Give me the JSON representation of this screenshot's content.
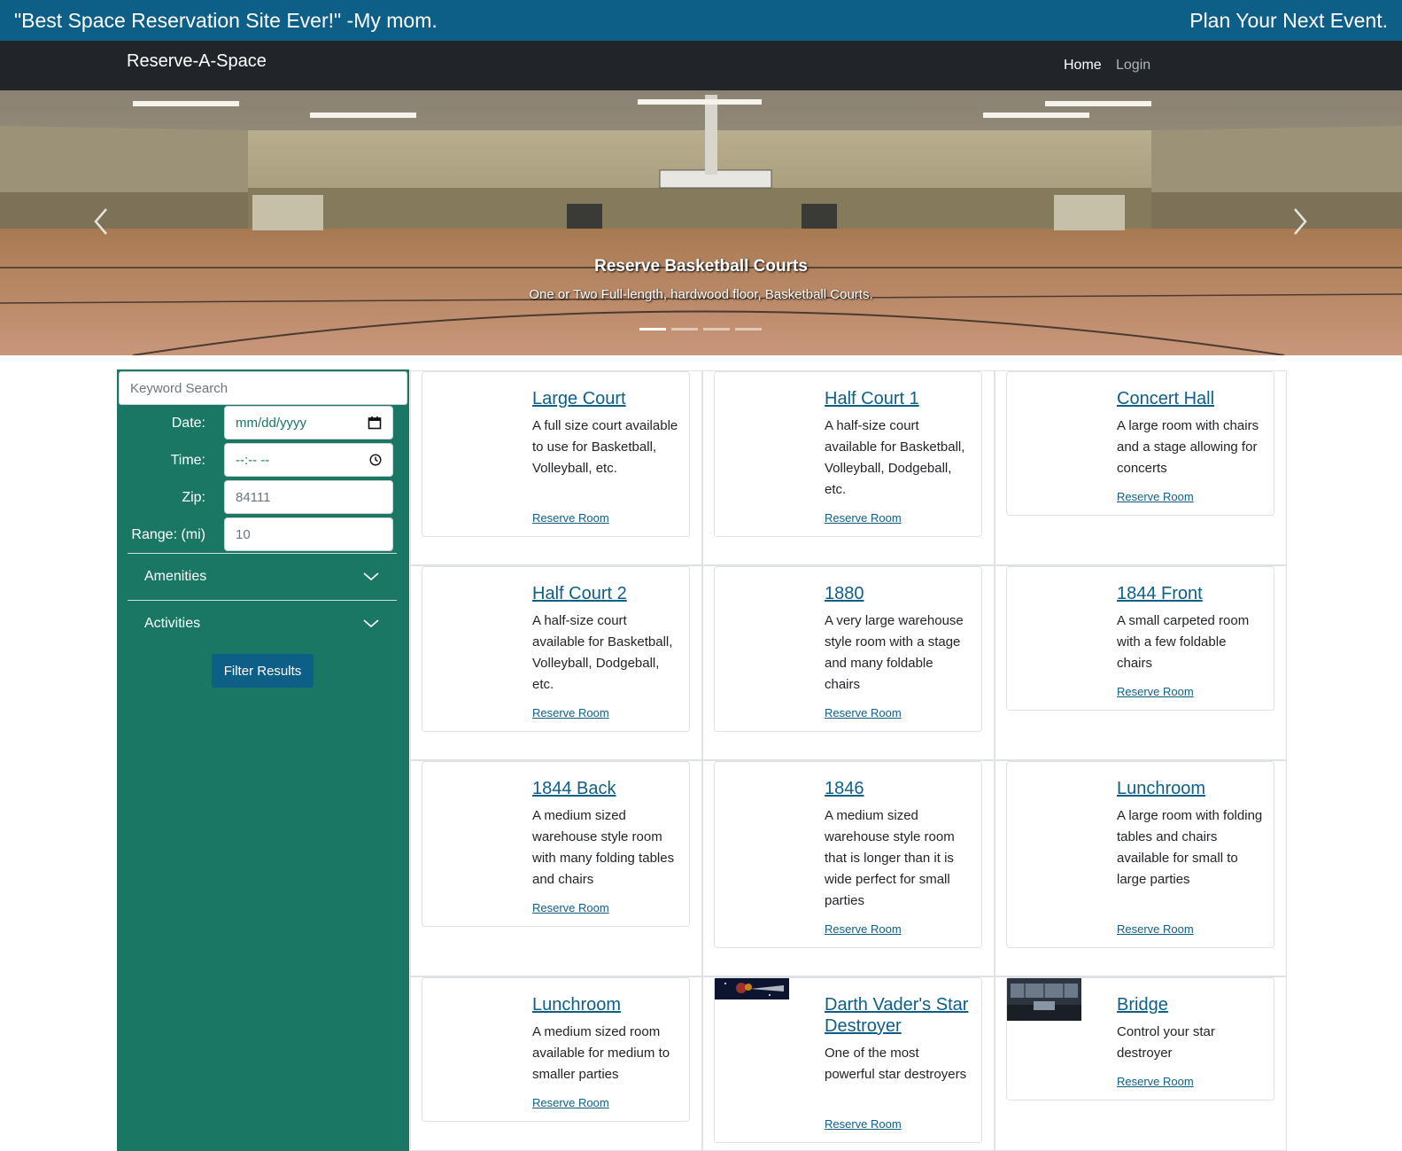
{
  "topbar": {
    "quote": "\"Best Space Reservation Site Ever!\" -My mom.",
    "tagline": "Plan Your Next Event."
  },
  "navbar": {
    "brand": "Reserve-A-Space",
    "links": [
      "Home",
      "Login"
    ]
  },
  "carousel": {
    "title": "Reserve Basketball Courts",
    "caption": "One or Two Full-length, hardwood floor, Basketball Courts.",
    "slide_count": 4,
    "active_slide": 1
  },
  "filters": {
    "keyword_placeholder": "Keyword Search",
    "date_label": "Date:",
    "date_placeholder": "mm/dd/yyyy",
    "time_label": "Time:",
    "time_placeholder": "--:-- --",
    "zip_label": "Zip:",
    "zip_value": "84111",
    "range_label": "Range: (mi)",
    "range_value": "10",
    "amenities_label": "Amenities",
    "activities_label": "Activities",
    "filter_button": "Filter Results"
  },
  "rooms": [
    {
      "name": "Large Court",
      "description": "A full size court available to use for Basketball, Volleyball, etc.",
      "link": "Reserve Room"
    },
    {
      "name": "Half Court 1",
      "description": "A half-size court available for Basketball, Volleyball, Dodgeball, etc.",
      "link": "Reserve Room"
    },
    {
      "name": "Concert Hall",
      "description": "A large room with chairs and a stage allowing for concerts",
      "link": "Reserve Room"
    },
    {
      "name": "Half Court 2",
      "description": "A half-size court available for Basketball, Volleyball, Dodgeball, etc.",
      "link": "Reserve Room"
    },
    {
      "name": "1880",
      "description": "A very large warehouse style room with a stage and many foldable chairs",
      "link": "Reserve Room"
    },
    {
      "name": "1844 Front",
      "description": "A small carpeted room with a few foldable chairs",
      "link": "Reserve Room"
    },
    {
      "name": "1844 Back",
      "description": "A medium sized warehouse style room with many folding tables and chairs",
      "link": "Reserve Room"
    },
    {
      "name": "1846",
      "description": "A medium sized warehouse style room that is longer than it is wide perfect for small parties",
      "link": "Reserve Room"
    },
    {
      "name": "Lunchroom",
      "description": "A large room with folding tables and chairs available for small to large parties",
      "link": "Reserve Room"
    },
    {
      "name": "Lunchroom",
      "description": "A medium sized room available for medium to smaller parties",
      "link": "Reserve Room"
    },
    {
      "name": "Darth Vader's Star Destroyer",
      "description": "One of the most powerful star destroyers",
      "link": "Reserve Room"
    },
    {
      "name": "Bridge",
      "description": "Control your star destroyer",
      "link": "Reserve Room"
    }
  ],
  "colors": {
    "topbar": "#0e5f87",
    "navbar": "#212529",
    "sidebar": "#1a7764",
    "link": "#0e5f87"
  }
}
